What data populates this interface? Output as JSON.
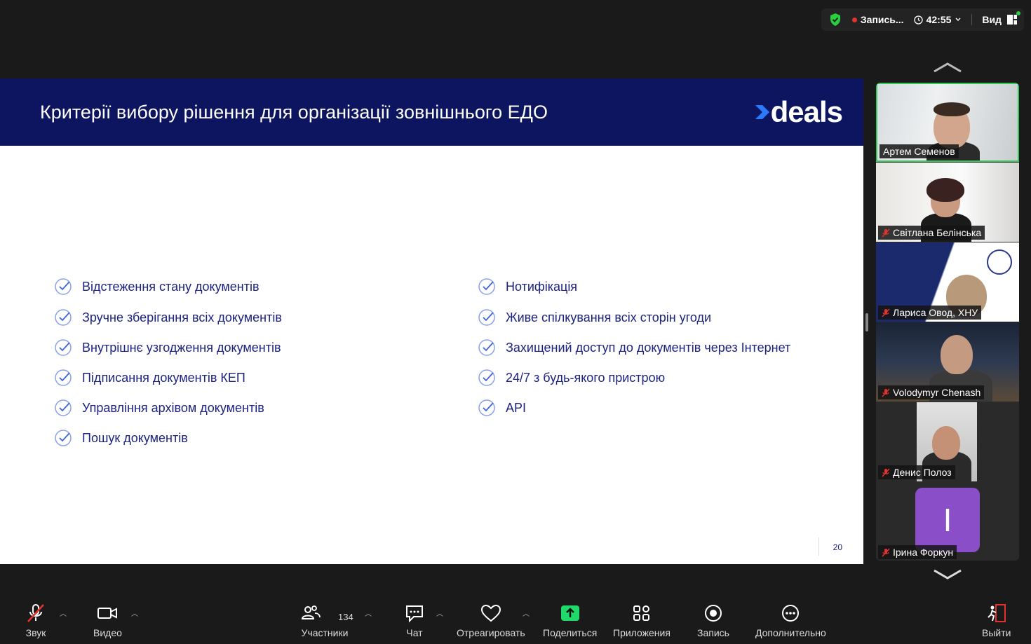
{
  "topbar": {
    "record_label": "Запись...",
    "timer": "42:55",
    "view_label": "Вид",
    "colors": {
      "record_dot": "#e5322d",
      "shield": "#2ecc40"
    }
  },
  "slide": {
    "title": "Критерії вибору рішення для організації зовнішнього ЕДО",
    "logo_text": "deals",
    "header_color": "#0d1460",
    "text_color": "#1c2380",
    "left_items": [
      "Відстеження стану документів",
      "Зручне зберігання всіх документів",
      "Внутрішнє узгодження документів",
      "Підписання документів КЕП",
      "Управління архівом документів",
      "Пошук документів"
    ],
    "right_items": [
      "Нотифікація",
      "Живе спілкування всіх сторін угоди",
      "Захищений доступ до документів через Інтернет",
      "24/7 з будь-якого пристрою",
      "API"
    ],
    "page_number": "20"
  },
  "participants": [
    {
      "name": "Артем Семенов",
      "muted": false,
      "active": true
    },
    {
      "name": "Світлана Белінська",
      "muted": true,
      "active": false
    },
    {
      "name": "Лариса Овод, ХНУ",
      "muted": true,
      "active": false
    },
    {
      "name": "Volodymyr Chenash",
      "muted": true,
      "active": false
    },
    {
      "name": "Денис Полоз",
      "muted": true,
      "active": false
    },
    {
      "name": "Ірина Форкун",
      "muted": true,
      "active": false,
      "initial": "I"
    }
  ],
  "toolbar": {
    "audio": "Звук",
    "video": "Видео",
    "participants": "Участники",
    "participants_count": "134",
    "chat": "Чат",
    "react": "Отреагировать",
    "share": "Поделиться",
    "apps": "Приложения",
    "record": "Запись",
    "more": "Дополнительно",
    "leave": "Выйти",
    "colors": {
      "share": "#1fd96b",
      "leave": "#e5322d",
      "mute_slash": "#e5322d"
    }
  }
}
